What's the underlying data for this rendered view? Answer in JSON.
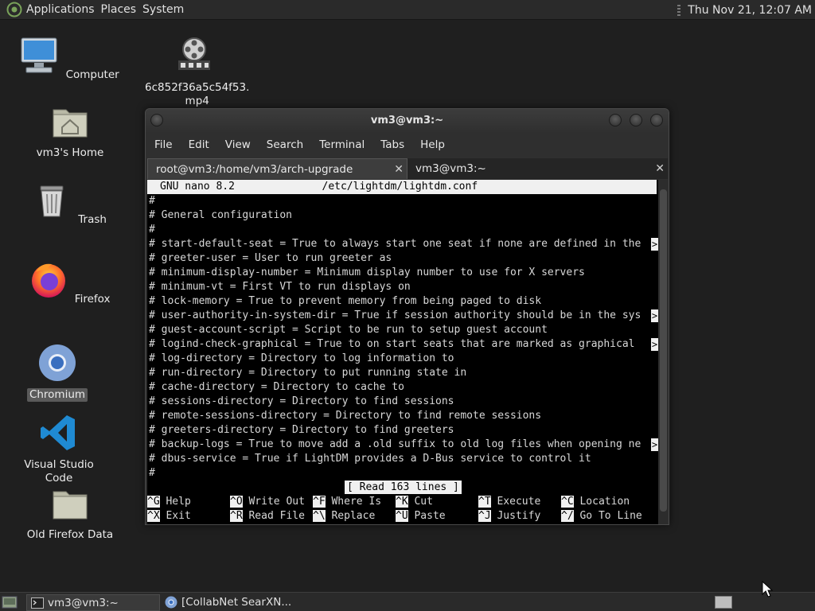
{
  "top_panel": {
    "menus": [
      "Applications",
      "Places",
      "System"
    ],
    "clock": "Thu Nov 21, 12:07 AM"
  },
  "desktop": {
    "icons": [
      {
        "label": "Computer",
        "icon": "computer-icon"
      },
      {
        "label": "6c852f36a5c54f53.\nmp4",
        "icon": "video-file-icon"
      },
      {
        "label": "vm3's Home",
        "icon": "home-folder-icon"
      },
      {
        "label": "Trash",
        "icon": "trash-icon"
      },
      {
        "label": "Firefox",
        "icon": "firefox-icon"
      },
      {
        "label": "Chromium",
        "icon": "chromium-icon",
        "selected": true
      },
      {
        "label": "Visual Studio Code",
        "icon": "vscode-icon"
      },
      {
        "label": "Old Firefox Data",
        "icon": "folder-icon"
      }
    ]
  },
  "window": {
    "title": "vm3@vm3:~",
    "menu": [
      "File",
      "Edit",
      "View",
      "Search",
      "Terminal",
      "Tabs",
      "Help"
    ],
    "tabs": [
      {
        "label": "root@vm3:/home/vm3/arch-upgrade",
        "active": true
      },
      {
        "label": "vm3@vm3:~",
        "active": false
      }
    ]
  },
  "nano": {
    "header": "GNU nano 8.2              /etc/lightdm/lightdm.conf",
    "lines": [
      {
        "text": "#",
        "truncated": false
      },
      {
        "text": "# General configuration",
        "truncated": false
      },
      {
        "text": "#",
        "truncated": false
      },
      {
        "text": "# start-default-seat = True to always start one seat if none are defined in the",
        "truncated": true
      },
      {
        "text": "# greeter-user = User to run greeter as",
        "truncated": false
      },
      {
        "text": "# minimum-display-number = Minimum display number to use for X servers",
        "truncated": false
      },
      {
        "text": "# minimum-vt = First VT to run displays on",
        "truncated": false
      },
      {
        "text": "# lock-memory = True to prevent memory from being paged to disk",
        "truncated": false
      },
      {
        "text": "# user-authority-in-system-dir = True if session authority should be in the sys",
        "truncated": true
      },
      {
        "text": "# guest-account-script = Script to be run to setup guest account",
        "truncated": false
      },
      {
        "text": "# logind-check-graphical = True to on start seats that are marked as graphical ",
        "truncated": true
      },
      {
        "text": "# log-directory = Directory to log information to",
        "truncated": false
      },
      {
        "text": "# run-directory = Directory to put running state in",
        "truncated": false
      },
      {
        "text": "# cache-directory = Directory to cache to",
        "truncated": false
      },
      {
        "text": "# sessions-directory = Directory to find sessions",
        "truncated": false
      },
      {
        "text": "# remote-sessions-directory = Directory to find remote sessions",
        "truncated": false
      },
      {
        "text": "# greeters-directory = Directory to find greeters",
        "truncated": false
      },
      {
        "text": "# backup-logs = True to move add a .old suffix to old log files when opening ne",
        "truncated": true
      },
      {
        "text": "# dbus-service = True if LightDM provides a D-Bus service to control it",
        "truncated": false
      },
      {
        "text": "#",
        "truncated": false
      }
    ],
    "truncation_marker": ">",
    "status": "[ Read 163 lines ]",
    "shortcuts": [
      [
        {
          "key": "^G",
          "label": "Help"
        },
        {
          "key": "^O",
          "label": "Write Out"
        },
        {
          "key": "^F",
          "label": "Where Is"
        },
        {
          "key": "^K",
          "label": "Cut"
        },
        {
          "key": "^T",
          "label": "Execute"
        },
        {
          "key": "^C",
          "label": "Location"
        }
      ],
      [
        {
          "key": "^X",
          "label": "Exit"
        },
        {
          "key": "^R",
          "label": "Read File"
        },
        {
          "key": "^\\",
          "label": "Replace"
        },
        {
          "key": "^U",
          "label": "Paste"
        },
        {
          "key": "^J",
          "label": "Justify"
        },
        {
          "key": "^/",
          "label": "Go To Line"
        }
      ]
    ]
  },
  "taskbar": {
    "tasks": [
      {
        "label": "vm3@vm3:~",
        "active": true
      },
      {
        "label": "[CollabNet SearXN...",
        "active": false
      }
    ]
  }
}
